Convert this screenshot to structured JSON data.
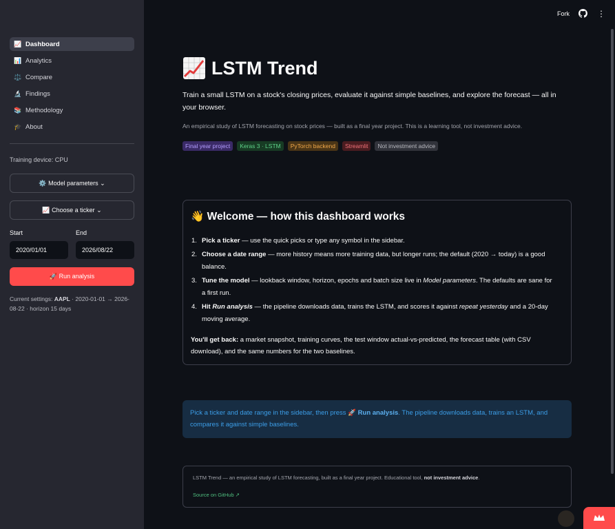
{
  "sidebar": {
    "nav": [
      {
        "label": "Dashboard",
        "icon": "📈",
        "icon_name": "chart-increasing-icon"
      },
      {
        "label": "Analytics",
        "icon": "📊",
        "icon_name": "bar-chart-icon"
      },
      {
        "label": "Compare",
        "icon": "⚖️",
        "icon_name": "balance-scale-icon"
      },
      {
        "label": "Findings",
        "icon": "🔬",
        "icon_name": "microscope-icon"
      },
      {
        "label": "Methodology",
        "icon": "📚",
        "icon_name": "books-icon"
      },
      {
        "label": "About",
        "icon": "🎓",
        "icon_name": "graduation-cap-icon"
      }
    ],
    "device": "Training device: CPU",
    "model_params_label": "⚙️ Model parameters ⌄",
    "ticker_label": "📈 Choose a ticker ⌄",
    "start_label": "Start",
    "end_label": "End",
    "start_value": "2020/01/01",
    "end_value": "2026/08/22",
    "run_label": "🚀 Run analysis",
    "settings_prefix": "Current settings: ",
    "settings_ticker": "AAPL",
    "settings_rest": " · 2020-01-01 → 2026-08-22 · horizon 15 days"
  },
  "header": {
    "fork": "Fork",
    "menu": "⋮"
  },
  "main": {
    "title": "LSTM Trend",
    "subtitle": "Train a small LSTM on a stock's closing prices, evaluate it against simple baselines, and explore the forecast — all in your browser.",
    "caption": "An empirical study of LSTM forecasting on stock prices — built as a final year project. This is a learning tool, not investment advice.",
    "badges": [
      {
        "label": "Final year project",
        "bg": "#3a2a66",
        "fg": "#b39dff"
      },
      {
        "label": "Keras 3 · LSTM",
        "bg": "#173b24",
        "fg": "#5fd38a"
      },
      {
        "label": "PyTorch backend",
        "bg": "#4a3516",
        "fg": "#f2a94a"
      },
      {
        "label": "Streamlit",
        "bg": "#4a1c20",
        "fg": "#f07178"
      },
      {
        "label": "Not investment advice",
        "bg": "#31333b",
        "fg": "#b8b9c0"
      }
    ]
  },
  "welcome": {
    "title": "👋 Welcome — how this dashboard works",
    "steps": [
      {
        "num": "1.",
        "bold": "Pick a ticker",
        "text": " — use the quick picks or type any symbol in the sidebar."
      },
      {
        "num": "2.",
        "bold": "Choose a date range",
        "text": " — more history means more training data, but longer runs; the default (2020 → today) is a good balance."
      },
      {
        "num": "3.",
        "bold": "Tune the model",
        "text": " — lookback window, horizon, epochs and batch size live in ",
        "em": "Model parameters",
        "tail": ". The defaults are sane for a first run."
      },
      {
        "num": "4.",
        "bold_pre": "Hit ",
        "bold_em": "Run analysis",
        "text": " — the pipeline downloads data, trains the LSTM, and scores it against ",
        "em": "repeat yesterday",
        "tail": " and a 20-day moving average."
      }
    ],
    "getback_bold": "You'll get back:",
    "getback_text": " a market snapshot, training curves, the test window actual-vs-predicted, the forecast table (with CSV download), and the same numbers for the two baselines."
  },
  "info": {
    "pre": "Pick a ticker and date range in the sidebar, then press 🚀 ",
    "bold": "Run analysis",
    "post": ". The pipeline downloads data, trains an LSTM, and compares it against simple baselines."
  },
  "footer": {
    "text": "LSTM Trend — an empirical study of LSTM forecasting, built as a final year project. Educational tool, ",
    "bold": "not investment advice",
    "end": ".",
    "link": "Source on GitHub ↗"
  },
  "colors": {
    "accent": "#ff4b4b",
    "sidebar_bg": "#262730",
    "main_bg": "#0e1117",
    "info_bg": "#172d43",
    "info_text": "#3c9ee8",
    "link": "#4fbf7f"
  }
}
